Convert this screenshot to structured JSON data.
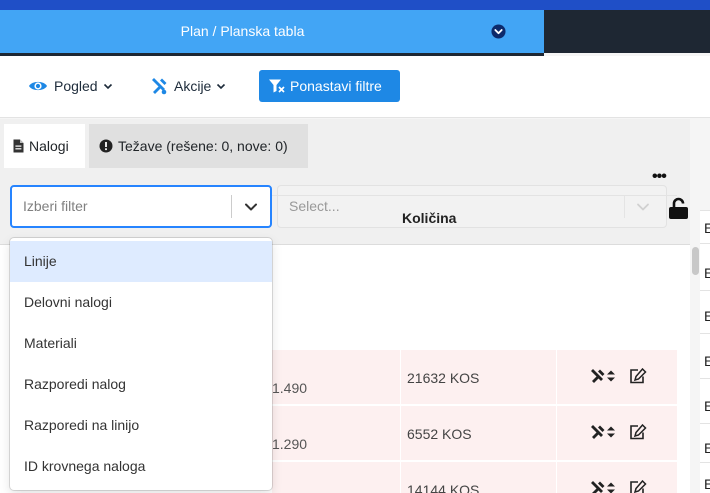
{
  "header": {
    "title": "Plan / Planska tabla",
    "chevron_icon": "chevron-circle-down-icon"
  },
  "toolbar": {
    "view": {
      "label": "Pogled",
      "icon": "eye-icon"
    },
    "actions": {
      "label": "Akcije",
      "icon": "tools-icon"
    },
    "reset_filters": {
      "label": "Ponastavi filtre",
      "icon": "filter-reset-icon"
    }
  },
  "tabs": [
    {
      "label": "Nalogi",
      "icon": "file-icon",
      "active": true
    },
    {
      "label": "Težave (rešene: 0, nove: 0)",
      "icon": "exclamation-circle-icon",
      "active": false
    }
  ],
  "filters": {
    "filter_select": {
      "placeholder": "Izberi filter"
    },
    "value_select": {
      "placeholder": "Select..."
    },
    "lock_icon": "unlock-icon"
  },
  "dropdown": {
    "options": [
      "Linije",
      "Delovni nalogi",
      "Materiali",
      "Razporedi nalog",
      "Razporedi na linijo",
      "ID krovnega naloga"
    ],
    "highlighted_index": 0
  },
  "table": {
    "more_menu": "•••",
    "column_quantity": "Količina",
    "rows": [
      {
        "left_value": "1.490",
        "quantity": "21632 KOS"
      },
      {
        "left_value": "1.290",
        "quantity": "6552 KOS"
      },
      {
        "left_value": "",
        "quantity": "14144 KOS"
      }
    ]
  },
  "edge_column": {
    "letters": [
      "E",
      "E",
      "E",
      "E",
      "E",
      "E",
      "E"
    ]
  },
  "colors": {
    "title_bar": "#42a5f5",
    "dark_panel": "#1e2733",
    "primary_button": "#1e88e5",
    "select_focus": "#2684ff",
    "row_highlight": "#fdf0f0",
    "option_highlight": "#deebff"
  }
}
